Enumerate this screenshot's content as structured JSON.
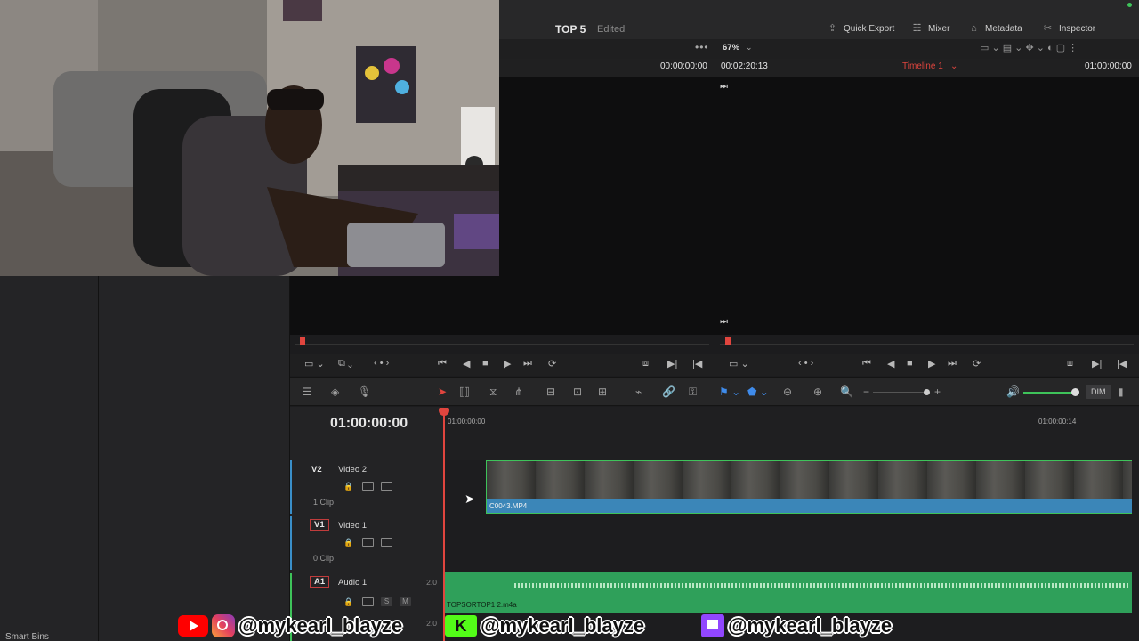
{
  "header": {
    "project_title": "TOP 5",
    "status": "Edited",
    "buttons": {
      "quick_export": "Quick Export",
      "mixer": "Mixer",
      "metadata": "Metadata",
      "inspector": "Inspector"
    }
  },
  "viewer": {
    "zoom": "67%",
    "source_timecode": "00:00:00:00",
    "duration_timecode": "00:02:20:13",
    "timeline_name": "Timeline 1",
    "record_timecode": "01:00:00:00"
  },
  "media_panel": {
    "smart_bins_label": "Smart Bins"
  },
  "timeline": {
    "current_timecode": "01:00:00:00",
    "ruler": {
      "start": "01:00:00:00",
      "mark2": "01:00:00:14"
    },
    "dim_label": "DIM",
    "tracks": [
      {
        "id": "V2",
        "name": "Video 2",
        "clip_count": "1 Clip"
      },
      {
        "id": "V1",
        "name": "Video 1",
        "clip_count": "0 Clip"
      },
      {
        "id": "A1",
        "name": "Audio 1",
        "channels": "2.0",
        "channels2": "2.0"
      }
    ],
    "video_clip_name": "C0043.MP4",
    "audio_clip_name": "TOPSORTOP1 2.m4a",
    "audio_btn_s": "S",
    "audio_btn_m": "M"
  },
  "overlay": {
    "handle1": "@mykearl_blayze",
    "handle2": "@mykearl_blayze",
    "handle3": "@mykearl_blayze",
    "kick_glyph": "K"
  },
  "colors": {
    "accent_red": "#e0453e",
    "track_green": "#3ec35a",
    "clip_blue": "#3b86b8"
  }
}
